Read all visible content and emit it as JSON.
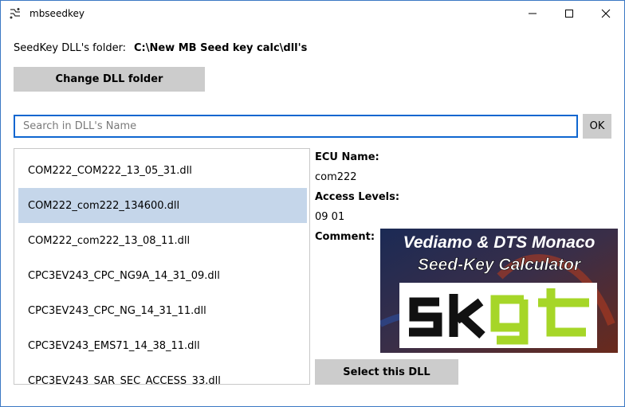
{
  "window": {
    "title": "mbseedkey"
  },
  "folder": {
    "label": "SeedKey DLL's folder:",
    "path": "C:\\New MB Seed key calc\\dll's",
    "change_button": "Change DLL folder"
  },
  "search": {
    "placeholder": "Search in DLL's Name",
    "value": "",
    "ok_button": "OK"
  },
  "dll_list": {
    "items": [
      "COM222_COM222_13_05_31.dll",
      "COM222_com222_134600.dll",
      "COM222_com222_13_08_11.dll",
      "CPC3EV243_CPC_NG9A_14_31_09.dll",
      "CPC3EV243_CPC_NG_14_31_11.dll",
      "CPC3EV243_EMS71_14_38_11.dll",
      "CPC3EV243_SAR_SEC_ACCESS_33.dll"
    ],
    "selected_index": 1
  },
  "details": {
    "ecu_name_label": "ECU Name:",
    "ecu_name_value": "com222",
    "access_levels_label": "Access Levels:",
    "access_levels_value": "09 01",
    "comment_label": "Comment:"
  },
  "logo": {
    "line1": "Vediamo & DTS Monaco",
    "line2": "Seed-Key Calculator",
    "brand": "skgt"
  },
  "select_button": "Select this DLL",
  "colors": {
    "accent_blue": "#0f66d0",
    "selection": "#c5d6ea",
    "button_gray": "#cccccc",
    "logo_green": "#a6d628"
  }
}
